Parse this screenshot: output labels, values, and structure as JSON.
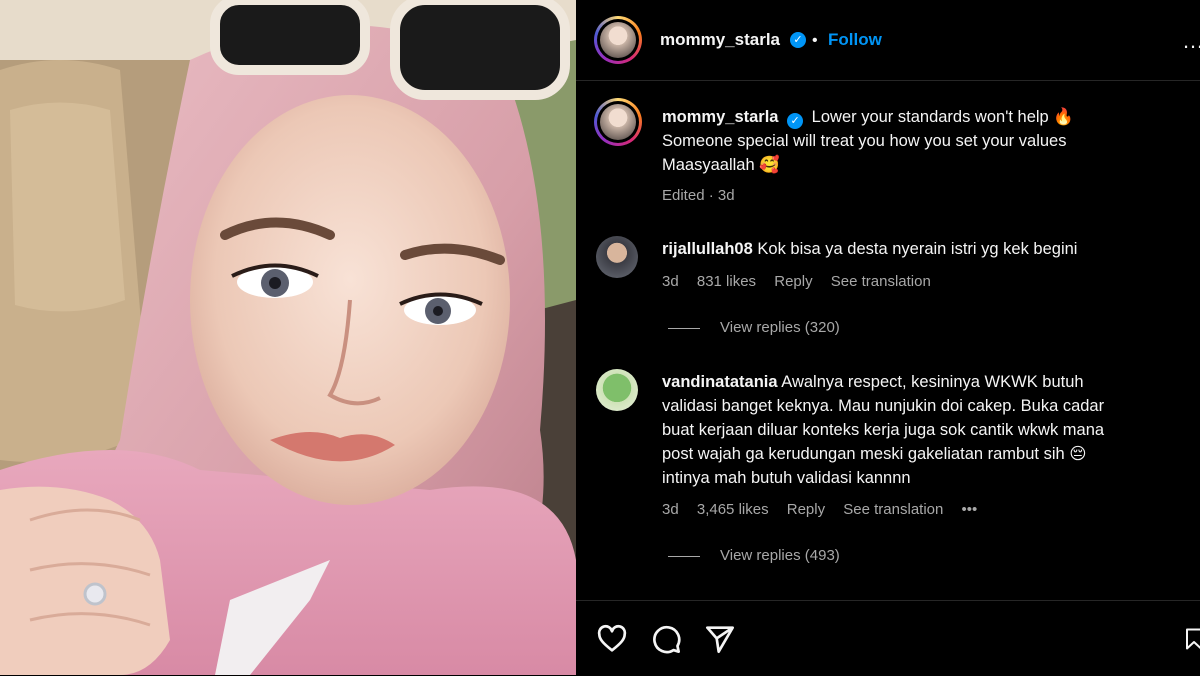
{
  "post": {
    "username": "mommy_starla",
    "separator": "•",
    "follow_label": "Follow",
    "more_label": "…"
  },
  "caption": {
    "username": "mommy_starla",
    "line1": "Lower your standards won't help 🔥",
    "line2": "Someone special will treat you how you set your values",
    "line3": "Maasyaallah 🥰",
    "meta": "Edited · 3d"
  },
  "comments": [
    {
      "username": "rijallullah08",
      "text": "Kok bisa ya desta nyerain istri yg kek begini",
      "time": "3d",
      "likes": "831 likes",
      "reply_label": "Reply",
      "translate_label": "See translation",
      "view_replies": "View replies (320)"
    },
    {
      "username": "vandinatatania",
      "text_line1": "Awalnya respect, kesininya WKWK butuh",
      "text_line2": "validasi banget keknya. Mau nunjukin doi cakep. Buka cadar",
      "text_line3": "buat kerjaan diluar konteks kerja juga sok cantik wkwk mana",
      "text_line4": "post wajah ga kerudungan meski gakeliatan rambut sih 😔",
      "text_line5": "intinya mah butuh validasi kannnn",
      "time": "3d",
      "likes": "3,465 likes",
      "reply_label": "Reply",
      "translate_label": "See translation",
      "more_label": "•••",
      "view_replies": "View replies (493)"
    }
  ],
  "icons": {
    "verified": "verified-badge-icon",
    "like": "heart-icon",
    "comment": "comment-bubble-icon",
    "share": "paper-plane-icon",
    "save": "bookmark-icon",
    "more": "more-options-icon"
  },
  "colors": {
    "background": "#000000",
    "link_blue": "#0095f6",
    "muted_text": "#a8a8a8"
  }
}
